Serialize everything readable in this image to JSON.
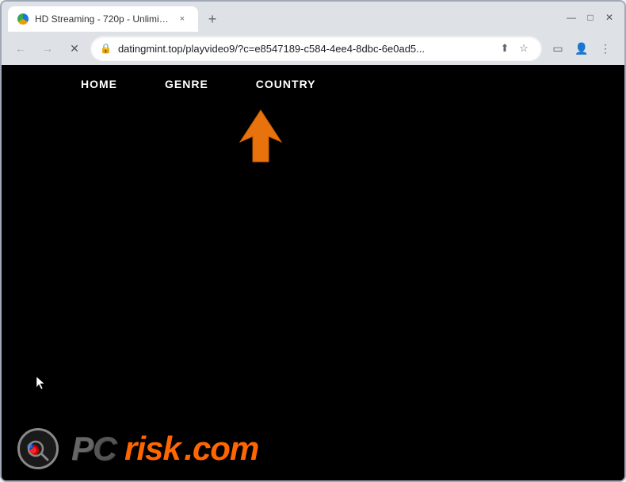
{
  "browser": {
    "tab_title": "HD Streaming - 720p - Unlimitec",
    "tab_favicon": "globe-icon",
    "url": "datingmint.top/playvideo9/?c=e8547189-c584-4ee4-8dbc-6e0ad5...",
    "close_tab_label": "×",
    "new_tab_label": "+",
    "window_controls": {
      "minimize": "—",
      "maximize": "□",
      "close": "✕"
    },
    "nav_back_label": "←",
    "nav_forward_label": "→",
    "nav_reload_label": "✕",
    "lock_icon": "🔒",
    "share_icon": "⬆",
    "bookmark_icon": "☆",
    "sidebar_icon": "▭",
    "profile_icon": "👤",
    "menu_icon": "⋮"
  },
  "webpage": {
    "nav_links": [
      {
        "label": "HOME",
        "id": "home"
      },
      {
        "label": "GENRE",
        "id": "genre"
      },
      {
        "label": "COUNTRY",
        "id": "country"
      }
    ]
  },
  "watermark": {
    "text_pc": "PC",
    "text_risk": "risk",
    "text_com": ".com"
  }
}
